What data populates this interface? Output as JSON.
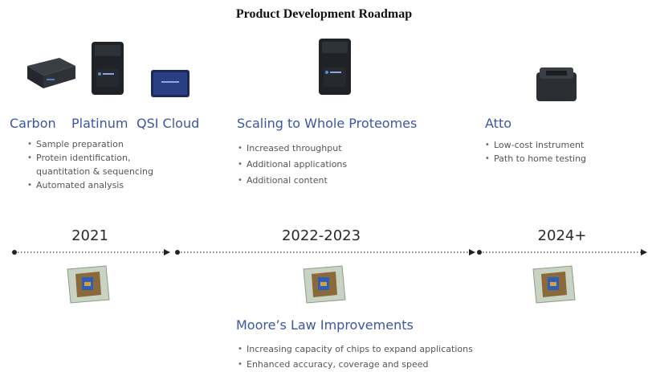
{
  "title": "Product Development Roadmap",
  "products": {
    "carbon": "Carbon",
    "platinum": "Platinum",
    "qsi_cloud": "QSI Cloud",
    "scaling": "Scaling to Whole Proteomes",
    "atto": "Atto"
  },
  "bullets_2021": [
    "Sample preparation",
    "Protein identification,",
    "quantitation & sequencing",
    "Automated analysis"
  ],
  "bullets_2022": [
    "Increased throughput",
    "Additional applications",
    "Additional content"
  ],
  "bullets_2024": [
    "Low-cost instrument",
    "Path to home testing"
  ],
  "years": [
    "2021",
    "2022-2023",
    "2024+"
  ],
  "moores_law": {
    "heading": "Moore’s Law Improvements",
    "bullets": [
      "Increasing capacity of chips to expand applications",
      "Enhanced accuracy, coverage and speed"
    ]
  },
  "colors": {
    "accent": "#3b56a6",
    "timeline": "#333333"
  },
  "icons": [
    "carbon-device-icon",
    "platinum-device-icon",
    "qsi-cloud-tablet-icon",
    "atto-device-icon",
    "chip-icon"
  ]
}
